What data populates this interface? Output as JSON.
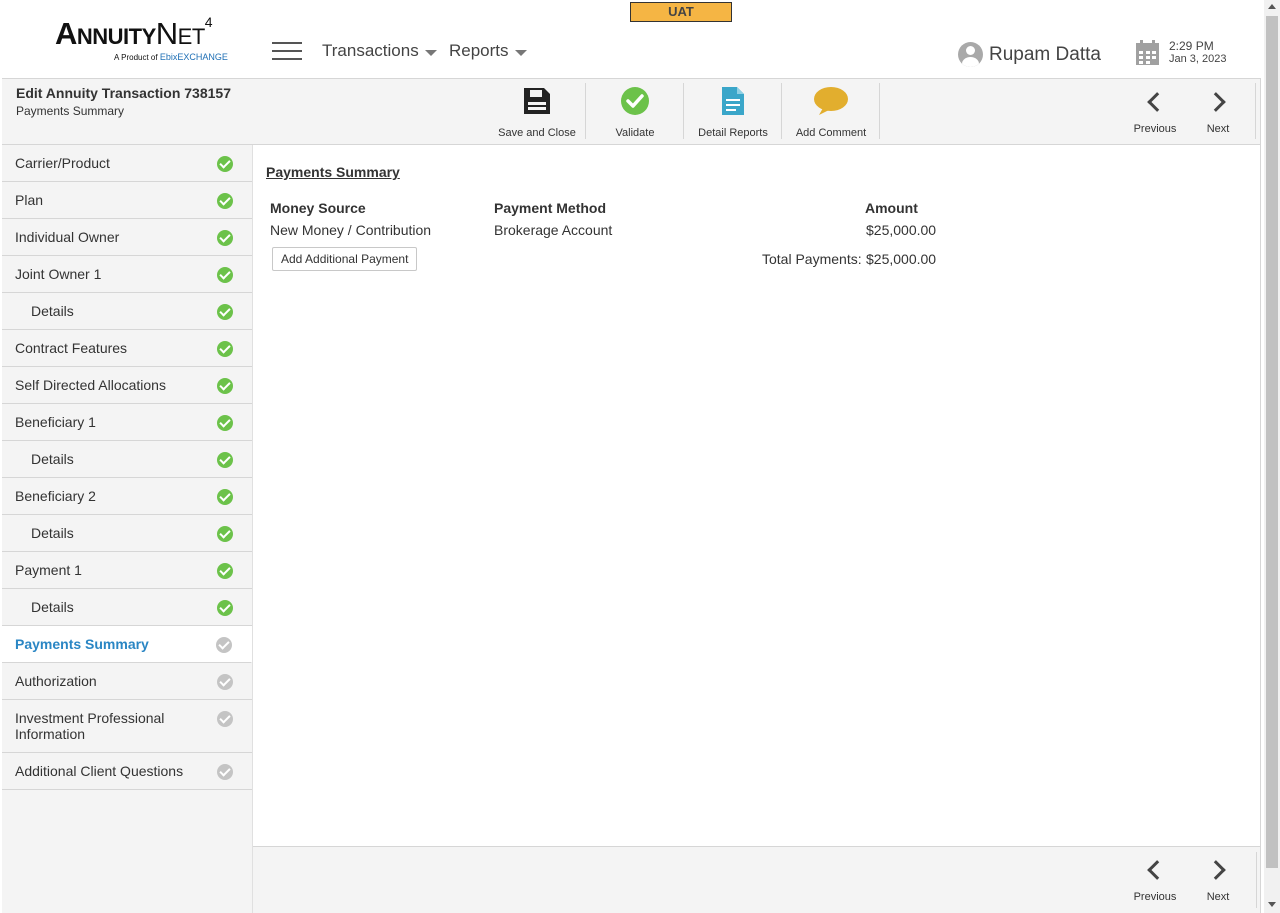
{
  "environment_badge": "UAT",
  "logo": {
    "name_part1_big": "A",
    "name_part1_small": "NNUITY",
    "name_part2_big": "N",
    "name_part2_small": "ET",
    "version": "4",
    "tagline": "A Product of ",
    "tagline_brand": "EbixEXCHANGE"
  },
  "nav": {
    "transactions": "Transactions",
    "reports": "Reports"
  },
  "user": {
    "name": "Rupam Datta"
  },
  "clock": {
    "time": "2:29 PM",
    "date": "Jan 3, 2023"
  },
  "toolbar": {
    "title": "Edit Annuity Transaction 738157",
    "subtitle": "Payments Summary",
    "save_close": "Save and Close",
    "validate": "Validate",
    "detail_reports": "Detail Reports",
    "add_comment": "Add Comment",
    "previous": "Previous",
    "next": "Next"
  },
  "colors": {
    "check_done": "#6cc24a",
    "check_pending": "#c4c4c4",
    "active_link": "#2a86c4",
    "badge": "#f5b544",
    "comment_icon": "#e2ae2e",
    "report_icon": "#3aa6c9"
  },
  "sidebar": {
    "items": [
      {
        "label": "Carrier/Product",
        "status": "done"
      },
      {
        "label": "Plan",
        "status": "done"
      },
      {
        "label": "Individual Owner",
        "status": "done"
      },
      {
        "label": "Joint Owner 1",
        "status": "done"
      },
      {
        "label": "Details",
        "status": "done"
      },
      {
        "label": "Contract Features",
        "status": "done"
      },
      {
        "label": "Self Directed Allocations",
        "status": "done"
      },
      {
        "label": "Beneficiary 1",
        "status": "done"
      },
      {
        "label": "Details",
        "status": "done"
      },
      {
        "label": "Beneficiary 2",
        "status": "done"
      },
      {
        "label": "Details",
        "status": "done"
      },
      {
        "label": "Payment 1",
        "status": "done"
      },
      {
        "label": "Details",
        "status": "done"
      },
      {
        "label": "Payments Summary",
        "status": "pending"
      },
      {
        "label": "Authorization",
        "status": "pending"
      },
      {
        "label": "Investment Professional Information",
        "status": "pending"
      },
      {
        "label": "Additional Client Questions",
        "status": "pending"
      }
    ]
  },
  "payments": {
    "title": "Payments Summary",
    "headers": {
      "money_source": "Money Source",
      "payment_method": "Payment Method",
      "amount": "Amount"
    },
    "rows": [
      {
        "money_source": "New Money / Contribution",
        "payment_method": "Brokerage Account",
        "amount": "$25,000.00"
      }
    ],
    "add_button": "Add Additional Payment",
    "total_label": "Total Payments:",
    "total_value": "$25,000.00"
  },
  "footer": {
    "previous": "Previous",
    "next": "Next"
  }
}
